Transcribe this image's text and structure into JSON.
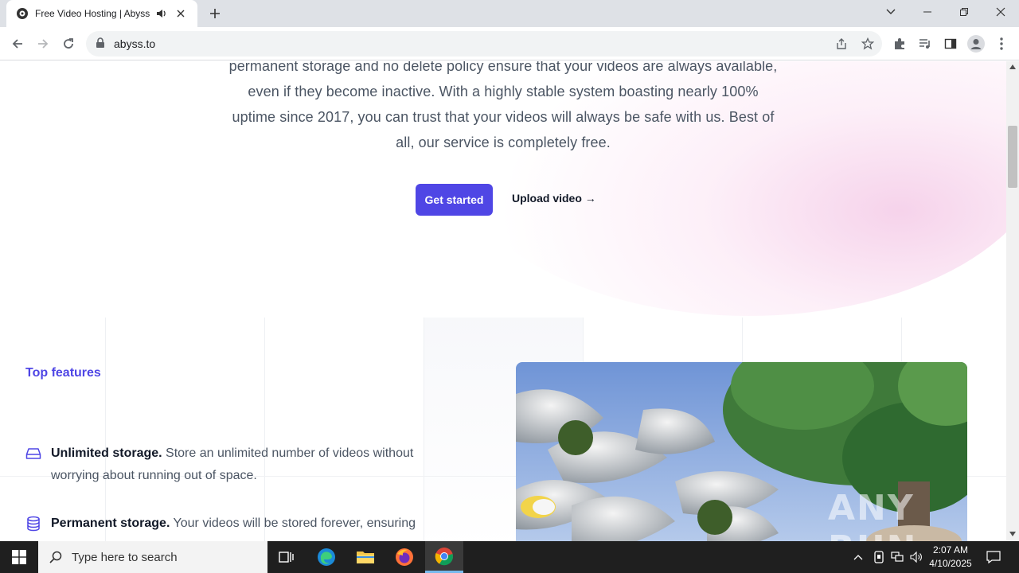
{
  "browser": {
    "tab_title": "Free Video Hosting | Abyss.to",
    "url": "abyss.to"
  },
  "page": {
    "hero_text": "permanent storage and no delete policy ensure that your videos are always available, even if they become inactive. With a highly stable system boasting nearly 100% uptime since 2017, you can trust that your videos will always be safe with us. Best of all, our service is completely free.",
    "get_started": "Get started",
    "upload_video": "Upload video →",
    "top_features": "Top features",
    "features": [
      {
        "icon": "storage-drive-icon",
        "title": "Unlimited storage.",
        "desc": " Store an unlimited number of videos without worrying about running out of space."
      },
      {
        "icon": "database-icon",
        "title": "Permanent storage.",
        "desc": " Your videos will be stored forever, ensuring"
      }
    ],
    "watermark": "ANY RUN",
    "accent_color": "#4f46e5"
  },
  "taskbar": {
    "search_placeholder": "Type here to search",
    "time": "2:07 AM",
    "date": "4/10/2025"
  }
}
